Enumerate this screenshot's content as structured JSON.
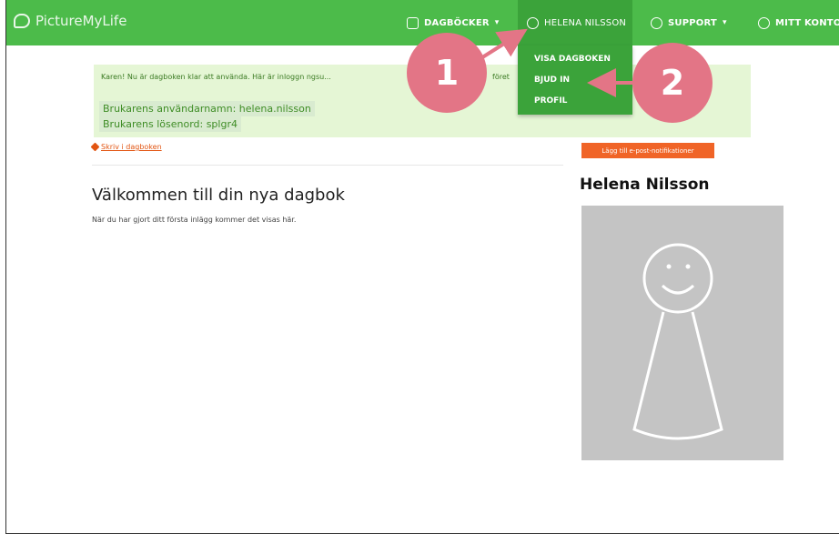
{
  "brand": {
    "name": "PictureMyLife"
  },
  "nav": {
    "diaries": "DAGBÖCKER",
    "user": "HELENA NILSSON",
    "support": "SUPPORT",
    "account": "MITT KONTO",
    "caret": "▾"
  },
  "dropdown": {
    "items": [
      "VISA DAGBOKEN",
      "BJUD IN",
      "PROFIL"
    ]
  },
  "alert": {
    "message": "Karen! Nu är dagboken klar att använda. Här är inloggn ngsu...",
    "message_tail": "föret",
    "username_line": "Brukarens användarnamn: helena.nilsson",
    "password_line": "Brukarens lösenord: splgr4"
  },
  "main": {
    "write_link": "Skriv i dagboken",
    "welcome_title": "Välkommen till din nya dagbok",
    "welcome_text": "När du har gjort ditt första inlägg kommer det visas här."
  },
  "sidebar": {
    "notify_button": "Lägg till e-post-notifikationer",
    "profile_name": "Helena Nilsson"
  },
  "callouts": {
    "first": "1",
    "second": "2"
  },
  "colors": {
    "nav": "#4cbb4a",
    "nav_active": "#3ba33a",
    "alert_bg": "#e5f6d5",
    "accent": "#f06427",
    "callout": "#e37586"
  }
}
